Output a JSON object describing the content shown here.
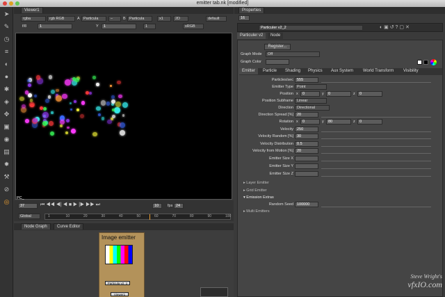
{
  "window": {
    "title": "emitter tab.nk [modified]"
  },
  "toolbar": {
    "icons": [
      "pointer-icon",
      "draw-icon",
      "time-icon",
      "channel-icon",
      "color-icon",
      "filter-icon",
      "keyer-icon",
      "merge-icon",
      "transform-icon",
      "3d-icon",
      "views-icon",
      "metadata-icon",
      "particles-icon",
      "toolsets-icon",
      "other-icon",
      "plugin-icon"
    ]
  },
  "viewer": {
    "tab_label": "Viewer1",
    "row1": {
      "channels": "rgba",
      "channel_sel": "rgb RGB",
      "a_label": "A",
      "a_input": "Particula",
      "b_label": "B",
      "b_input": "Particula",
      "zoom": "x1",
      "mode": "2D",
      "lut": "default"
    },
    "row2": {
      "fstop_label": "f/8",
      "gain": "1",
      "y_label": "Y",
      "gamma": "1",
      "frame": "1",
      "colorspace": "sRGB"
    },
    "overlay_label": "PC_",
    "timeline": {
      "frame": "37",
      "step": "10",
      "fps_label": "fps",
      "fps": "24",
      "range_mode": "Global",
      "ticks": [
        "1",
        "10",
        "20",
        "30",
        "40",
        "50",
        "60",
        "70",
        "80",
        "90",
        "100"
      ]
    }
  },
  "nodegraph": {
    "tabs": [
      "Node Graph",
      "Curve Editor"
    ],
    "backdrop_label": "Image emitter",
    "nodes": [
      "Particula v2_1",
      "Viewer1"
    ]
  },
  "watermark": {
    "line1": "Steve Wright's",
    "line2": "vfxIO.com"
  },
  "properties": {
    "tab_label": "Properties",
    "count": "16",
    "node_name": "Particuler v2_2",
    "subtabs": [
      "Particuler v2",
      "Node"
    ],
    "register_label": "Register...",
    "graph_mode_label": "Graph Mode",
    "graph_mode_value": "Off",
    "graph_color_label": "Graph Color",
    "param_tabs": [
      "Emitter",
      "Particle",
      "Shading",
      "Physics",
      "Aux System",
      "World Transform",
      "Visibility"
    ],
    "params": {
      "particles_sec": {
        "label": "Particles/sec",
        "value": "555"
      },
      "emitter_type": {
        "label": "Emitter Type",
        "value": "Point"
      },
      "position": {
        "label": "Position",
        "x": "0",
        "y": "0",
        "z": "0"
      },
      "position_subframe": {
        "label": "Position Subframe",
        "value": "Linear"
      },
      "direction": {
        "label": "Direction",
        "value": "Directional"
      },
      "direction_spread": {
        "label": "Direction Spread [%]",
        "value": "20"
      },
      "rotation": {
        "label": "Rotation",
        "x": "0",
        "y": "80",
        "z": "0"
      },
      "velocity": {
        "label": "Velocity",
        "value": "250"
      },
      "velocity_random": {
        "label": "Velocity Random [%]",
        "value": "30"
      },
      "velocity_distribution": {
        "label": "Velocity Distribution",
        "value": "0.5"
      },
      "velocity_from_motion": {
        "label": "Velocity from Motion [%]",
        "value": "20"
      },
      "emitter_size_x": {
        "label": "Emitter Size X",
        "value": ""
      },
      "emitter_size_y": {
        "label": "Emitter Size Y",
        "value": ""
      },
      "emitter_size_z": {
        "label": "Emitter Size Z",
        "value": ""
      }
    },
    "sections": [
      "Layer Emitter",
      "Grid Emitter",
      "Emission Extras",
      "Multi Emitters"
    ],
    "random_seed": {
      "label": "Random Seed",
      "value": "100000"
    }
  },
  "colors": {
    "panel_bg": "#3a3a3a",
    "viewer_bg": "#000000",
    "backdrop": "#b3925a",
    "accent": "#f0a030"
  }
}
